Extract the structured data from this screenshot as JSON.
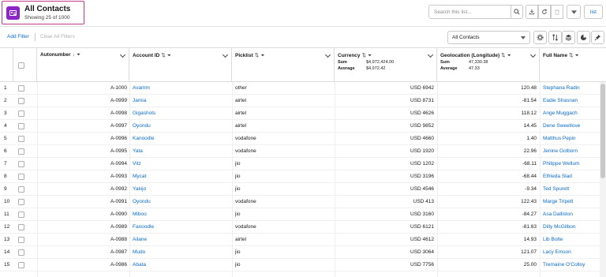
{
  "header": {
    "title": "All Contacts",
    "subtitle": "Showing 25 of 1000",
    "search_placeholder": "Search this list...",
    "list_label": "list",
    "icons": [
      "contact-card-icon",
      "search-icon",
      "export-icon",
      "refresh-icon",
      "delete-icon",
      "chevron-down-icon"
    ]
  },
  "toolbar": {
    "add_filter": "Add Filter",
    "clear_filters": "Clear All Filters",
    "view_select": "All Contacts",
    "icons": [
      "gear-icon",
      "sort-icon",
      "layers-icon",
      "pie-icon",
      "pin-icon"
    ]
  },
  "columns": {
    "autonumber": "Autonumber",
    "account_id": "Account ID",
    "picklist": "Picklist",
    "currency": "Currency",
    "geolocation": "Geolocation (Longitude)",
    "full_name": "Full Name"
  },
  "aggregates": {
    "currency": {
      "sum_label": "Sum",
      "sum": "$4,972,424.00",
      "avg_label": "Average",
      "avg": "$4,972.42"
    },
    "geolocation": {
      "sum_label": "Sum",
      "sum": "47,330.38",
      "avg_label": "Average",
      "avg": "47.33"
    }
  },
  "rows": [
    {
      "n": "1",
      "auto": "A-1000",
      "account": "Avamm",
      "pick": "other",
      "currency": "USD 6942",
      "geo": "120.48",
      "name": "Stephana Radin"
    },
    {
      "n": "2",
      "auto": "A-0999",
      "account": "Jamia",
      "pick": "airtel",
      "currency": "USD 8731",
      "geo": "-81.54",
      "name": "Eadie Shasnan"
    },
    {
      "n": "3",
      "auto": "A-0998",
      "account": "Gigashots",
      "pick": "airtel",
      "currency": "USD 4626",
      "geo": "118.12",
      "name": "Ange Muggach"
    },
    {
      "n": "4",
      "auto": "A-0997",
      "account": "Oyondu",
      "pick": "airtel",
      "currency": "USD 9852",
      "geo": "14.45",
      "name": "Dene Sweetlove"
    },
    {
      "n": "5",
      "auto": "A-0996",
      "account": "Kanoodle",
      "pick": "vodafone",
      "currency": "USD 4660",
      "geo": "1.40",
      "name": "Matthus Pepin"
    },
    {
      "n": "6",
      "auto": "A-0995",
      "account": "Yata",
      "pick": "vodafone",
      "currency": "USD 1920",
      "geo": "22.96",
      "name": "Jenine Golborn"
    },
    {
      "n": "7",
      "auto": "A-0994",
      "account": "Vitz",
      "pick": "jio",
      "currency": "USD 1202",
      "geo": "-68.11",
      "name": "Philippe Wellum"
    },
    {
      "n": "8",
      "auto": "A-0993",
      "account": "Mycat",
      "pick": "jio",
      "currency": "USD 3196",
      "geo": "-68.44",
      "name": "Elfrieda Slad"
    },
    {
      "n": "9",
      "auto": "A-0992",
      "account": "Yakijo",
      "pick": "jio",
      "currency": "USD 4546",
      "geo": "-9.34",
      "name": "Ted Spurett"
    },
    {
      "n": "10",
      "auto": "A-0991",
      "account": "Oyondu",
      "pick": "vodafone",
      "currency": "USD 413",
      "geo": "122.43",
      "name": "Marge Tripett"
    },
    {
      "n": "11",
      "auto": "A-0990",
      "account": "Miboo",
      "pick": "jio",
      "currency": "USD 3160",
      "geo": "-84.27",
      "name": "Asa Dalliston"
    },
    {
      "n": "12",
      "auto": "A-0989",
      "account": "Fanoodle",
      "pick": "vodafone",
      "currency": "USD 6121",
      "geo": "-81.63",
      "name": "Dilly McGilbon"
    },
    {
      "n": "13",
      "auto": "A-0988",
      "account": "Ailane",
      "pick": "airtel",
      "currency": "USD 4612",
      "geo": "14.93",
      "name": "Lib Bolte"
    },
    {
      "n": "14",
      "auto": "A-0987",
      "account": "Mudo",
      "pick": "jio",
      "currency": "USD 3064",
      "geo": "121.07",
      "name": "Lacy Emson"
    },
    {
      "n": "15",
      "auto": "A-0986",
      "account": "Abata",
      "pick": "jio",
      "currency": "USD 7756",
      "geo": "25.00",
      "name": "Tremaine O'Colloy"
    }
  ],
  "colors": {
    "accent": "#0b6bcb",
    "app_icon": "#8c26c7",
    "highlight_border": "#c23a8b"
  }
}
